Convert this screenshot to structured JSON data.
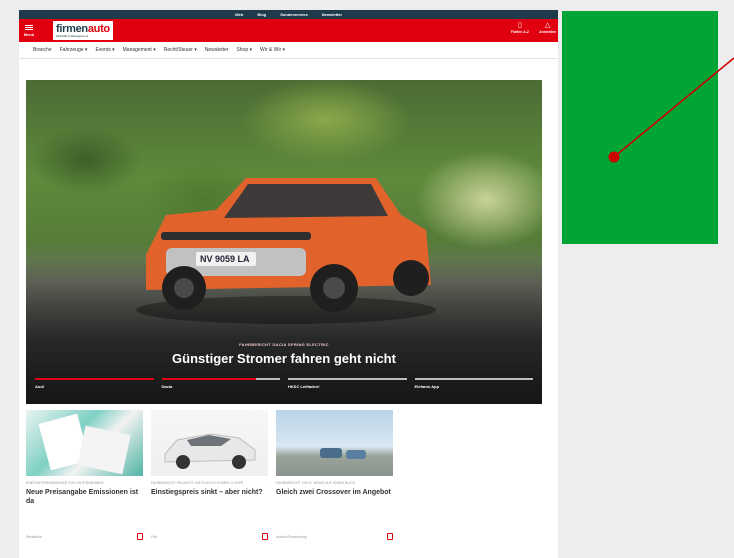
{
  "topbar": {
    "links": [
      "Web",
      "Blog",
      "Sonderservice",
      "Newsletter"
    ],
    "bg_color": "#1e3a4b"
  },
  "header": {
    "menu_label": "Menü",
    "logo_text_a": "firmen",
    "logo_text_b": "auto",
    "logo_tagline": "Mobilität & Management",
    "actions": [
      {
        "icon": "document-icon",
        "label": "Flotten A-Z"
      },
      {
        "icon": "bell-icon",
        "label": "Anmelden"
      }
    ],
    "accent_color": "#e1000f"
  },
  "nav": {
    "items": [
      "Branche",
      "Fahrzeuge ▾",
      "Events ▾",
      "Management ▾",
      "Recht/Steuer ▾",
      "Newsletter",
      "Shop ▾",
      "Wir & Wir ▾"
    ]
  },
  "hero": {
    "kicker": "FAHRBERICHT DACIA SPRING ELECTRIC",
    "title": "Günstiger Stromer fahren geht nicht",
    "plate": "NV 9059 LA",
    "slides": [
      {
        "label": "Audi",
        "progress": 1.0
      },
      {
        "label": "Dacia",
        "progress": 0.8
      },
      {
        "label": "HKSC Leitfaden!",
        "progress": 0
      },
      {
        "label": "Elefanto App",
        "progress": 0
      }
    ]
  },
  "cards": [
    {
      "kicker": "ENERGIEPREISBREMSE FÜR UNTERNEHMEN",
      "title": "Neue Preisangabe Emissionen ist da",
      "author": "Redaktion"
    },
    {
      "kicker": "FAHRBERICHT PEUGEOT 408 PLUG-IN HYBRID COUPÉ",
      "title": "Einstiegspreis sinkt – aber nicht?",
      "author": "Fiat"
    },
    {
      "kicker": "FAHRBERICHT VW ID. NEWS AUF EINEM BLICK",
      "title": "Gleich zwei Crossover im Angebot",
      "author": "Autorin/Fortsetzung"
    }
  ],
  "ad": {
    "color": "#00a536"
  },
  "annotation": {
    "color": "#cc0000"
  }
}
